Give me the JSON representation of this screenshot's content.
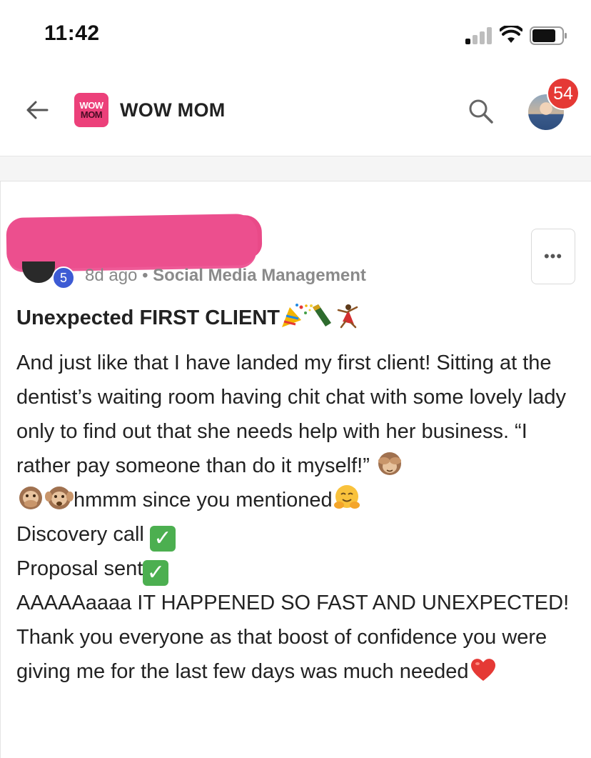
{
  "status_bar": {
    "time": "11:42"
  },
  "header": {
    "logo_line1": "WOW",
    "logo_line2": "MOM",
    "title": "WOW MOM",
    "notification_count": "54"
  },
  "post": {
    "level": "5",
    "time_ago": "8d ago",
    "separator": " • ",
    "category": "Social Media Management",
    "more_label": "•••",
    "title": "Unexpected FIRST CLIENT",
    "body": {
      "line1": "And just like that I have landed my first client! Sitting at the dentist’s waiting room having chit chat with some lovely lady only to find out that she needs help with her business. “I rather pay someone than do it myself!” ",
      "line2": "hmmm since you mentioned",
      "discovery": "Discovery call ",
      "proposal": "Proposal sent",
      "closing": "AAAAAaaaa IT HAPPENED SO FAST AND UNEXPECTED! Thank you everyone as that boost of confidence you were giving me for the last few days was much needed"
    },
    "emojis": {
      "title": [
        "party-popper",
        "champagne",
        "dancer"
      ],
      "monkeys": [
        "see-no-evil-monkey",
        "speak-no-evil-monkey",
        "hear-no-evil-monkey"
      ],
      "hug": "hugging-face",
      "check": "check-mark-button",
      "heart": "red-heart"
    }
  },
  "colors": {
    "brand_pink": "#ec407a",
    "badge_red": "#e53935",
    "level_blue": "#3d5bd4",
    "check_green": "#4caf50",
    "heart_red": "#e53935"
  }
}
